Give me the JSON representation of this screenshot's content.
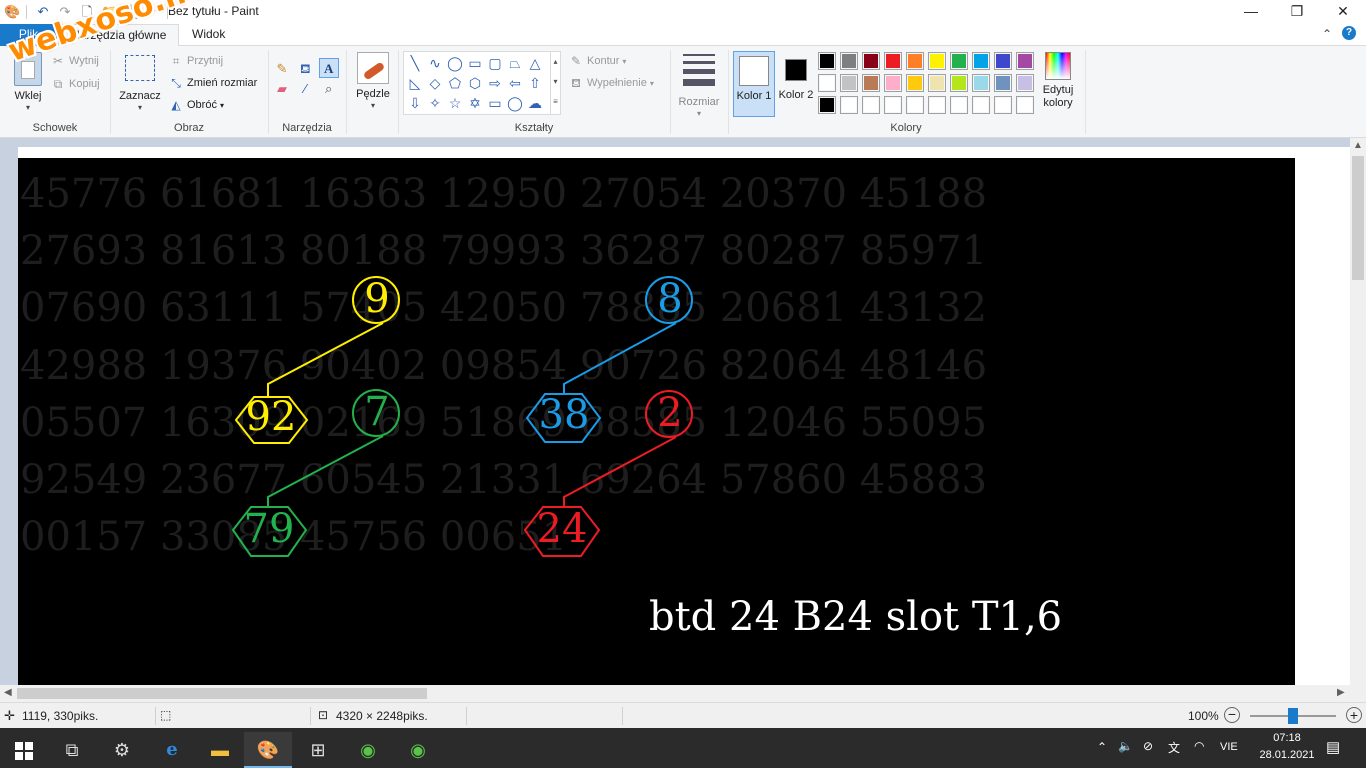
{
  "window": {
    "title": "Bez tytułu - Paint",
    "minimize": "—",
    "maximize": "❐",
    "close": "✕"
  },
  "ribbon_tabs": {
    "file": "Plik",
    "home": "Narzędzia główne",
    "view": "Widok",
    "collapse": "⌃",
    "help": "?"
  },
  "clipboard": {
    "paste": "Wklej",
    "cut": "Wytnij",
    "copy": "Kopiuj",
    "group": "Schowek"
  },
  "image_group": {
    "select": "Zaznacz",
    "crop": "Przytnij",
    "resize": "Zmień rozmiar",
    "rotate": "Obróć",
    "group": "Obraz"
  },
  "tools_group": {
    "group": "Narzędzia"
  },
  "brushes": {
    "label": "Pędzle"
  },
  "shapes_group": {
    "outline": "Kontur",
    "fill": "Wypełnienie",
    "group": "Kształty"
  },
  "size": {
    "label": "Rozmiar"
  },
  "colors_group": {
    "color1": "Kolor 1",
    "color2": "Kolor 2",
    "edit": "Edytuj kolory",
    "group": "Kolory",
    "color1_value": "#ffffff",
    "color2_value": "#000000",
    "palette_row1": [
      "#000000",
      "#7f7f7f",
      "#880015",
      "#ed1c24",
      "#ff7f27",
      "#fff200",
      "#22b14c",
      "#00a2e8",
      "#3f48cc",
      "#a349a4"
    ],
    "palette_row2": [
      "#ffffff",
      "#c3c3c3",
      "#b97a57",
      "#ffaec9",
      "#ffc90e",
      "#efe4b0",
      "#b5e61d",
      "#99d9ea",
      "#7092be",
      "#c8bfe7"
    ],
    "palette_row3": [
      "#000000",
      "#ffffff",
      "#ffffff",
      "#ffffff",
      "#ffffff",
      "#ffffff",
      "#ffffff",
      "#ffffff",
      "#ffffff",
      "#ffffff"
    ]
  },
  "drawing": {
    "background_rows": [
      "45776 61681 16363 12950 27054 20370 45188",
      "27693 81613 80188 79993 36287 80287 85971",
      "07690 63111 57405 42050 78885 20681 43132",
      "42988 19376 90402 09854 90726 82064 48146",
      "05507 16309 02169 51869 68585 12046 55095",
      "92549 23677 60545 21331 69264 57860 45883",
      "00157 33085 45756 00651"
    ],
    "marks": [
      {
        "text": "9",
        "color": "#ffee00"
      },
      {
        "text": "92",
        "color": "#ffee00"
      },
      {
        "text": "7",
        "color": "#22b14c"
      },
      {
        "text": "79",
        "color": "#22b14c"
      },
      {
        "text": "8",
        "color": "#1a9be6"
      },
      {
        "text": "38",
        "color": "#1a9be6"
      },
      {
        "text": "2",
        "color": "#ed1c24"
      },
      {
        "text": "24",
        "color": "#ed1c24"
      }
    ],
    "caption": "btd 24 B24 slot T1,6"
  },
  "statusbar": {
    "cursor_pos": "1119, 330piks.",
    "image_size": "4320 × 2248piks.",
    "zoom": "100%",
    "zoom_level_percent": 100
  },
  "taskbar": {
    "language": "VIE",
    "time": "07:18",
    "date": "28.01.2021"
  },
  "watermark": "webxoso.net"
}
